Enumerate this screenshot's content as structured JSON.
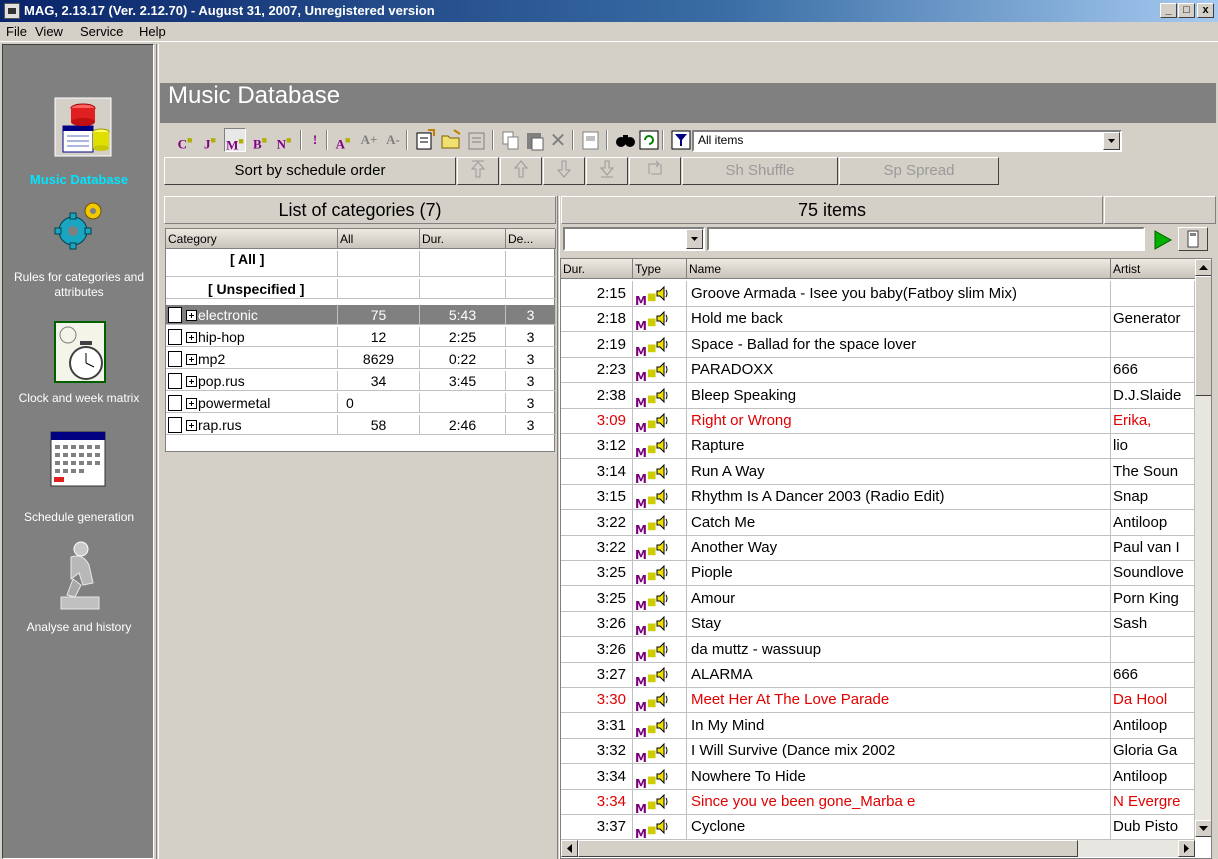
{
  "window": {
    "title": "MAG, 2.13.17 (Ver. 2.12.70) - August 31, 2007, Unregistered version",
    "minimize": "_",
    "maximize": "□",
    "close": "x"
  },
  "menu": [
    "File",
    "View",
    "Service",
    "Help"
  ],
  "sidebar": {
    "items": [
      {
        "label": "Music Database",
        "icon": "database-icon",
        "active": true
      },
      {
        "label": "Rules for categories and attributes",
        "icon": "gears-icon"
      },
      {
        "label": "Clock and week matrix",
        "icon": "clock-matrix-icon"
      },
      {
        "label": "Schedule generation",
        "icon": "calendar-icon"
      },
      {
        "label": "Analyse and history",
        "icon": "thinker-statue-icon"
      }
    ]
  },
  "header": {
    "title": "Music Database"
  },
  "toolbar": {
    "filter_select": "All items",
    "buttons": [
      "C",
      "J",
      "M",
      "B",
      "N",
      "!",
      "A",
      "A+",
      "A-"
    ]
  },
  "sortbar": {
    "sort_label": "Sort by schedule order",
    "shuffle_label": "Sh Shuffle",
    "spread_label": "Sp Spread"
  },
  "categories_panel": {
    "title": "List of categories (7)",
    "columns": [
      "Category",
      "All",
      "Dur.",
      "De..."
    ],
    "rows": [
      {
        "name": "[ All ]",
        "bold": true
      },
      {
        "name": "[ Unspecified ]",
        "bold": true
      },
      {
        "name": "electronic",
        "all": "75",
        "dur": "5:43",
        "de": "3",
        "selected": true
      },
      {
        "name": "hip-hop",
        "all": "12",
        "dur": "2:25",
        "de": "3"
      },
      {
        "name": "mp2",
        "all": "8629",
        "dur": "0:22",
        "de": "3"
      },
      {
        "name": "pop.rus",
        "all": "34",
        "dur": "3:45",
        "de": "3"
      },
      {
        "name": "powermetal",
        "all": "0",
        "dur": "",
        "de": "3"
      },
      {
        "name": "rap.rus",
        "all": "58",
        "dur": "2:46",
        "de": "3"
      }
    ]
  },
  "tracks_panel": {
    "count_label": "75 items",
    "columns": [
      "Dur.",
      "Type",
      "Name",
      "Artist"
    ],
    "rows": [
      {
        "dur": "2:15",
        "name": "Groove Armada - Isee you baby(Fatboy slim Mix)",
        "artist": ""
      },
      {
        "dur": "2:18",
        "name": "Hold me back",
        "artist": "Generator"
      },
      {
        "dur": "2:19",
        "name": "Space - Ballad for the space lover",
        "artist": ""
      },
      {
        "dur": "2:23",
        "name": "PARADOXX",
        "artist": "666"
      },
      {
        "dur": "2:38",
        "name": "Bleep Speaking",
        "artist": "D.J.Slaide"
      },
      {
        "dur": "3:09",
        "name": "Right or Wrong",
        "artist": "Erika,",
        "red": true
      },
      {
        "dur": "3:12",
        "name": "Rapture",
        "artist": "lio"
      },
      {
        "dur": "3:14",
        "name": "Run A Way",
        "artist": "The Soun"
      },
      {
        "dur": "3:15",
        "name": "Rhythm Is A Dancer 2003 (Radio Edit)",
        "artist": "Snap"
      },
      {
        "dur": "3:22",
        "name": "Catch Me",
        "artist": "Antiloop"
      },
      {
        "dur": "3:22",
        "name": "Another Way",
        "artist": "Paul van I"
      },
      {
        "dur": "3:25",
        "name": "Piople",
        "artist": "Soundlove"
      },
      {
        "dur": "3:25",
        "name": "Amour",
        "artist": "Porn King"
      },
      {
        "dur": "3:26",
        "name": "Stay",
        "artist": "Sash"
      },
      {
        "dur": "3:26",
        "name": "da muttz - wassuup",
        "artist": ""
      },
      {
        "dur": "3:27",
        "name": "ALARMA",
        "artist": "666"
      },
      {
        "dur": "3:30",
        "name": "Meet Her At The Love Parade",
        "artist": "Da Hool",
        "red": true
      },
      {
        "dur": "3:31",
        "name": "In My Mind",
        "artist": "Antiloop"
      },
      {
        "dur": "3:32",
        "name": "I Will Survive (Dance mix 2002",
        "artist": "Gloria Ga"
      },
      {
        "dur": "3:34",
        "name": "Nowhere To Hide",
        "artist": "Antiloop"
      },
      {
        "dur": "3:34",
        "name": "Since you ve been gone_Marba e",
        "artist": "N Evergre",
        "red": true
      },
      {
        "dur": "3:37",
        "name": "Cyclone",
        "artist": "Dub Pisto"
      }
    ]
  },
  "colors": {
    "accent": "#00e5ff",
    "red_text": "#e00000",
    "play": "#00b000"
  }
}
